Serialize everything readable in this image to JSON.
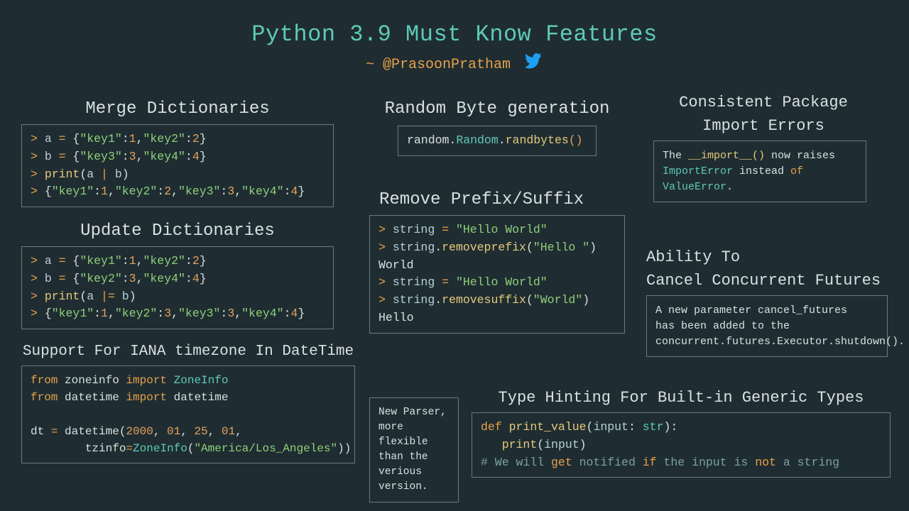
{
  "title": "Python 3.9 Must Know Features",
  "author_prefix": "~ ",
  "author_handle": "@PrasoonPratham",
  "sections": {
    "merge": {
      "title": "Merge Dictionaries"
    },
    "update": {
      "title": "Update Dictionaries"
    },
    "iana": {
      "title": "Support For IANA timezone In DateTime"
    },
    "randbytes": {
      "title": "Random Byte generation"
    },
    "prefix": {
      "title": "Remove Prefix/Suffix"
    },
    "parser": {
      "text": "New Parser,\n more flexible\nthan the\n verious version."
    },
    "import_errors": {
      "title1": "Consistent Package",
      "title2": "Import Errors",
      "text_parts": [
        "The ",
        "__import__()",
        " now raises ",
        "ImportError",
        " instead ",
        "of",
        " ",
        "ValueError",
        "."
      ]
    },
    "cancel": {
      "title1": "Ability To",
      "title2": "Cancel Concurrent Futures",
      "text": "A new parameter cancel_futures\nhas been added to the\nconcurrent.futures.Executor.shutdown()."
    },
    "typehint": {
      "title": "Type Hinting For Built-in Generic Types"
    }
  },
  "code": {
    "merge": [
      {
        "prompt": "> ",
        "tokens": [
          [
            "a",
            "v"
          ],
          [
            " ",
            "p"
          ],
          [
            "=",
            "op"
          ],
          [
            " {",
            "p"
          ],
          [
            "\"key1\"",
            "s"
          ],
          [
            ":",
            "p"
          ],
          [
            "1",
            "n"
          ],
          [
            ",",
            "p"
          ],
          [
            "\"key2\"",
            "s"
          ],
          [
            ":",
            "p"
          ],
          [
            "2",
            "n"
          ],
          [
            "}",
            "p"
          ]
        ]
      },
      {
        "prompt": "> ",
        "tokens": [
          [
            "b",
            "v"
          ],
          [
            " ",
            "p"
          ],
          [
            "=",
            "op"
          ],
          [
            " {",
            "p"
          ],
          [
            "\"key3\"",
            "s"
          ],
          [
            ":",
            "p"
          ],
          [
            "3",
            "n"
          ],
          [
            ",",
            "p"
          ],
          [
            "\"key4\"",
            "s"
          ],
          [
            ":",
            "p"
          ],
          [
            "4",
            "n"
          ],
          [
            "}",
            "p"
          ]
        ]
      },
      {
        "prompt": "> ",
        "tokens": [
          [
            "print",
            "fn"
          ],
          [
            "(",
            "p"
          ],
          [
            "a",
            "v"
          ],
          [
            " | ",
            "op"
          ],
          [
            "b",
            "v"
          ],
          [
            ")",
            "p"
          ]
        ]
      },
      {
        "prompt": "> ",
        "tokens": [
          [
            "{",
            "p"
          ],
          [
            "\"key1\"",
            "s"
          ],
          [
            ":",
            "p"
          ],
          [
            "1",
            "n"
          ],
          [
            ",",
            "p"
          ],
          [
            "\"key2\"",
            "s"
          ],
          [
            ":",
            "p"
          ],
          [
            "2",
            "n"
          ],
          [
            ",",
            "p"
          ],
          [
            "\"key3\"",
            "s"
          ],
          [
            ":",
            "p"
          ],
          [
            "3",
            "n"
          ],
          [
            ",",
            "p"
          ],
          [
            "\"key4\"",
            "s"
          ],
          [
            ":",
            "p"
          ],
          [
            "4",
            "n"
          ],
          [
            "}",
            "p"
          ]
        ]
      }
    ],
    "update": [
      {
        "prompt": "> ",
        "tokens": [
          [
            "a",
            "v"
          ],
          [
            " ",
            "p"
          ],
          [
            "=",
            "op"
          ],
          [
            " {",
            "p"
          ],
          [
            "\"key1\"",
            "s"
          ],
          [
            ":",
            "p"
          ],
          [
            "1",
            "n"
          ],
          [
            ",",
            "p"
          ],
          [
            "\"key2\"",
            "s"
          ],
          [
            ":",
            "p"
          ],
          [
            "2",
            "n"
          ],
          [
            "}",
            "p"
          ]
        ]
      },
      {
        "prompt": "> ",
        "tokens": [
          [
            "b",
            "v"
          ],
          [
            " ",
            "p"
          ],
          [
            "=",
            "op"
          ],
          [
            " {",
            "p"
          ],
          [
            "\"key2\"",
            "s"
          ],
          [
            ":",
            "p"
          ],
          [
            "3",
            "n"
          ],
          [
            ",",
            "p"
          ],
          [
            "\"key4\"",
            "s"
          ],
          [
            ":",
            "p"
          ],
          [
            "4",
            "n"
          ],
          [
            "}",
            "p"
          ]
        ]
      },
      {
        "prompt": "> ",
        "tokens": [
          [
            "print",
            "fn"
          ],
          [
            "(",
            "p"
          ],
          [
            "a",
            "v"
          ],
          [
            " |= ",
            "op"
          ],
          [
            "b",
            "v"
          ],
          [
            ")",
            "p"
          ]
        ]
      },
      {
        "prompt": "> ",
        "tokens": [
          [
            "{",
            "p"
          ],
          [
            "\"key1\"",
            "s"
          ],
          [
            ":",
            "p"
          ],
          [
            "1",
            "n"
          ],
          [
            ",",
            "p"
          ],
          [
            "\"key2\"",
            "s"
          ],
          [
            ":",
            "p"
          ],
          [
            "3",
            "n"
          ],
          [
            ",",
            "p"
          ],
          [
            "\"key3\"",
            "s"
          ],
          [
            ":",
            "p"
          ],
          [
            "3",
            "n"
          ],
          [
            ",",
            "p"
          ],
          [
            "\"key4\"",
            "s"
          ],
          [
            ":",
            "p"
          ],
          [
            "4",
            "n"
          ],
          [
            "}",
            "p"
          ]
        ]
      }
    ],
    "iana": [
      {
        "prompt": "",
        "tokens": [
          [
            "from",
            "kw"
          ],
          [
            " zoneinfo ",
            "p"
          ],
          [
            "import",
            "kw"
          ],
          [
            " ",
            "p"
          ],
          [
            "ZoneInfo",
            "ty"
          ]
        ]
      },
      {
        "prompt": "",
        "tokens": [
          [
            "from",
            "kw"
          ],
          [
            " datetime ",
            "p"
          ],
          [
            "import",
            "kw"
          ],
          [
            " datetime",
            "p"
          ]
        ]
      },
      {
        "prompt": "",
        "tokens": [
          [
            "",
            "p"
          ]
        ]
      },
      {
        "prompt": "",
        "tokens": [
          [
            "dt ",
            "p"
          ],
          [
            "=",
            "op"
          ],
          [
            " datetime(",
            "p"
          ],
          [
            "2000",
            "n"
          ],
          [
            ", ",
            "p"
          ],
          [
            "01",
            "n"
          ],
          [
            ", ",
            "p"
          ],
          [
            "25",
            "n"
          ],
          [
            ", ",
            "p"
          ],
          [
            "01",
            "n"
          ],
          [
            ",",
            "p"
          ]
        ]
      },
      {
        "prompt": "",
        "tokens": [
          [
            "        tzinfo",
            "p"
          ],
          [
            "=",
            "op"
          ],
          [
            "ZoneInfo",
            "ty"
          ],
          [
            "(",
            "p"
          ],
          [
            "\"America/Los_Angeles\"",
            "s"
          ],
          [
            "))",
            "p"
          ]
        ]
      }
    ],
    "randbytes": [
      {
        "prompt": "",
        "tokens": [
          [
            "random",
            "p"
          ],
          [
            ".",
            "p"
          ],
          [
            "Random",
            "ty"
          ],
          [
            ".",
            "p"
          ],
          [
            "randbytes",
            "fn"
          ],
          [
            "()",
            "op"
          ]
        ]
      }
    ],
    "prefix": [
      {
        "prompt": "> ",
        "tokens": [
          [
            "string",
            "v"
          ],
          [
            " ",
            "p"
          ],
          [
            "=",
            "op"
          ],
          [
            " ",
            "p"
          ],
          [
            "\"Hello World\"",
            "s"
          ]
        ]
      },
      {
        "prompt": "> ",
        "tokens": [
          [
            "string",
            "v"
          ],
          [
            ".",
            "p"
          ],
          [
            "removeprefix",
            "fn"
          ],
          [
            "(",
            "p"
          ],
          [
            "\"Hello \"",
            "s"
          ],
          [
            ")",
            "p"
          ]
        ]
      },
      {
        "prompt": "",
        "tokens": [
          [
            "World",
            "p"
          ]
        ]
      },
      {
        "prompt": "> ",
        "tokens": [
          [
            "string",
            "v"
          ],
          [
            " ",
            "p"
          ],
          [
            "=",
            "op"
          ],
          [
            " ",
            "p"
          ],
          [
            "\"Hello World\"",
            "s"
          ]
        ]
      },
      {
        "prompt": "> ",
        "tokens": [
          [
            "string",
            "v"
          ],
          [
            ".",
            "p"
          ],
          [
            "removesuffix",
            "fn"
          ],
          [
            "(",
            "p"
          ],
          [
            "\"World\"",
            "s"
          ],
          [
            ")",
            "p"
          ]
        ]
      },
      {
        "prompt": "",
        "tokens": [
          [
            "Hello",
            "p"
          ]
        ]
      }
    ],
    "typehint": [
      {
        "prompt": "",
        "tokens": [
          [
            "def",
            "kw"
          ],
          [
            " ",
            "p"
          ],
          [
            "print_value",
            "fn"
          ],
          [
            "(",
            "p"
          ],
          [
            "input",
            "v"
          ],
          [
            ": ",
            "p"
          ],
          [
            "str",
            "ty"
          ],
          [
            "):",
            "p"
          ]
        ]
      },
      {
        "prompt": "",
        "tokens": [
          [
            "   ",
            "p"
          ],
          [
            "print",
            "fn"
          ],
          [
            "(",
            "p"
          ],
          [
            "input",
            "v"
          ],
          [
            ")",
            "p"
          ]
        ]
      },
      {
        "prompt": "",
        "tokens": [
          [
            "# We will ",
            "cm"
          ],
          [
            "get",
            "sp"
          ],
          [
            " notified ",
            "cm"
          ],
          [
            "if",
            "sp"
          ],
          [
            " the input is ",
            "cm"
          ],
          [
            "not",
            "sp"
          ],
          [
            " a string",
            "cm"
          ]
        ]
      }
    ]
  }
}
